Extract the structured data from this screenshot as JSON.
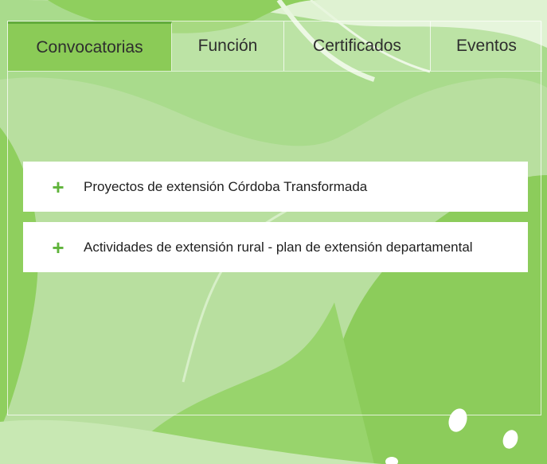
{
  "tabs": [
    {
      "label": "Convocatorias",
      "active": true
    },
    {
      "label": "Función",
      "active": false
    },
    {
      "label": "Certificados",
      "active": false
    },
    {
      "label": "Eventos",
      "active": false
    }
  ],
  "accordion": {
    "items": [
      {
        "icon": "plus-icon",
        "symbol": "+",
        "label": "Proyectos de extensión Córdoba Transformada"
      },
      {
        "icon": "plus-icon",
        "symbol": "+",
        "label": "Actividades de extensión rural - plan de extensión departamental"
      }
    ]
  },
  "colors": {
    "background": "#a7d98a",
    "active_tab": "#8bcb57",
    "accent": "#5fb33a",
    "card": "#ffffff"
  }
}
